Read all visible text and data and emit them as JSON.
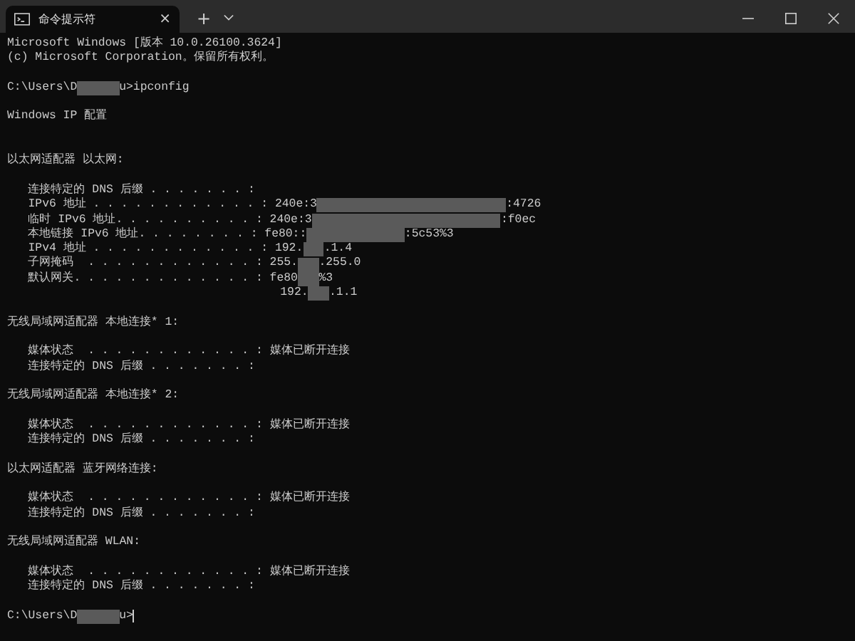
{
  "tab": {
    "title": "命令提示符",
    "selected": true,
    "close": "×"
  },
  "new_tab": "+",
  "lines": [
    {
      "kind": "output",
      "parts": [
        {
          "kind": "text",
          "text": "Microsoft Windows [版本 10.0.26100.3624]"
        }
      ]
    },
    {
      "kind": "output",
      "parts": [
        {
          "kind": "text",
          "text": "(c) Microsoft Corporation。保留所有权利。"
        }
      ]
    },
    {
      "kind": "blank"
    },
    {
      "kind": "output",
      "parts": [
        {
          "kind": "text",
          "text": "C:\\Users\\D"
        },
        {
          "kind": "mediummask"
        },
        {
          "kind": "text",
          "text": "u>ipconfig"
        }
      ]
    },
    {
      "kind": "blank"
    },
    {
      "kind": "output",
      "parts": [
        {
          "kind": "text",
          "text": "Windows IP 配置"
        }
      ]
    },
    {
      "kind": "blank"
    },
    {
      "kind": "blank"
    },
    {
      "kind": "output",
      "parts": [
        {
          "kind": "text",
          "text": "以太网适配器 以太网:"
        }
      ]
    },
    {
      "kind": "blank"
    },
    {
      "kind": "output",
      "parts": [
        {
          "kind": "text",
          "text": "   连接特定的 DNS 后缀 . . . . . . . :"
        }
      ]
    },
    {
      "kind": "output",
      "parts": [
        {
          "kind": "text",
          "text": "   IPv6 地址 . . . . . . . . . . . . : 240e:3"
        },
        {
          "kind": "longmask"
        },
        {
          "kind": "text",
          "text": ":4726"
        }
      ]
    },
    {
      "kind": "output",
      "parts": [
        {
          "kind": "text",
          "text": "   临时 IPv6 地址. . . . . . . . . . : 240e:3"
        },
        {
          "kind": "longmask"
        },
        {
          "kind": "text",
          "text": ":f0ec"
        }
      ]
    },
    {
      "kind": "output",
      "parts": [
        {
          "kind": "text",
          "text": "   本地链接 IPv6 地址. . . . . . . . : fe80::"
        },
        {
          "kind": "widemask"
        },
        {
          "kind": "text",
          "text": ":5c53%3"
        }
      ]
    },
    {
      "kind": "output",
      "parts": [
        {
          "kind": "text",
          "text": "   IPv4 地址 . . . . . . . . . . . . : 192."
        },
        {
          "kind": "shortmask"
        },
        {
          "kind": "text",
          "text": ".1.4"
        }
      ]
    },
    {
      "kind": "output",
      "parts": [
        {
          "kind": "text",
          "text": "   子网掩码  . . . . . . . . . . . . : 255."
        },
        {
          "kind": "shortmask"
        },
        {
          "kind": "text",
          "text": ".255.0"
        }
      ]
    },
    {
      "kind": "output",
      "parts": [
        {
          "kind": "text",
          "text": "   默认网关. . . . . . . . . . . . . : fe80"
        },
        {
          "kind": "shortmask"
        },
        {
          "kind": "text",
          "text": "%3"
        }
      ]
    },
    {
      "kind": "output",
      "parts": [
        {
          "kind": "text",
          "text": "                                       192."
        },
        {
          "kind": "shortmask"
        },
        {
          "kind": "text",
          "text": ".1.1"
        }
      ]
    },
    {
      "kind": "blank"
    },
    {
      "kind": "output",
      "parts": [
        {
          "kind": "text",
          "text": "无线局域网适配器 本地连接* 1:"
        }
      ]
    },
    {
      "kind": "blank"
    },
    {
      "kind": "output",
      "parts": [
        {
          "kind": "text",
          "text": "   媒体状态  . . . . . . . . . . . . : 媒体已断开连接"
        }
      ]
    },
    {
      "kind": "output",
      "parts": [
        {
          "kind": "text",
          "text": "   连接特定的 DNS 后缀 . . . . . . . :"
        }
      ]
    },
    {
      "kind": "blank"
    },
    {
      "kind": "output",
      "parts": [
        {
          "kind": "text",
          "text": "无线局域网适配器 本地连接* 2:"
        }
      ]
    },
    {
      "kind": "blank"
    },
    {
      "kind": "output",
      "parts": [
        {
          "kind": "text",
          "text": "   媒体状态  . . . . . . . . . . . . : 媒体已断开连接"
        }
      ]
    },
    {
      "kind": "output",
      "parts": [
        {
          "kind": "text",
          "text": "   连接特定的 DNS 后缀 . . . . . . . :"
        }
      ]
    },
    {
      "kind": "blank"
    },
    {
      "kind": "output",
      "parts": [
        {
          "kind": "text",
          "text": "以太网适配器 蓝牙网络连接:"
        }
      ]
    },
    {
      "kind": "blank"
    },
    {
      "kind": "output",
      "parts": [
        {
          "kind": "text",
          "text": "   媒体状态  . . . . . . . . . . . . : 媒体已断开连接"
        }
      ]
    },
    {
      "kind": "output",
      "parts": [
        {
          "kind": "text",
          "text": "   连接特定的 DNS 后缀 . . . . . . . :"
        }
      ]
    },
    {
      "kind": "blank"
    },
    {
      "kind": "output",
      "parts": [
        {
          "kind": "text",
          "text": "无线局域网适配器 WLAN:"
        }
      ]
    },
    {
      "kind": "blank"
    },
    {
      "kind": "output",
      "parts": [
        {
          "kind": "text",
          "text": "   媒体状态  . . . . . . . . . . . . : 媒体已断开连接"
        }
      ]
    },
    {
      "kind": "output",
      "parts": [
        {
          "kind": "text",
          "text": "   连接特定的 DNS 后缀 . . . . . . . :"
        }
      ]
    },
    {
      "kind": "blank"
    },
    {
      "kind": "prompt",
      "cursor": true,
      "parts": [
        {
          "kind": "text",
          "text": "C:\\Users\\D"
        },
        {
          "kind": "mediummask"
        },
        {
          "kind": "text",
          "text": "u>"
        }
      ]
    }
  ]
}
